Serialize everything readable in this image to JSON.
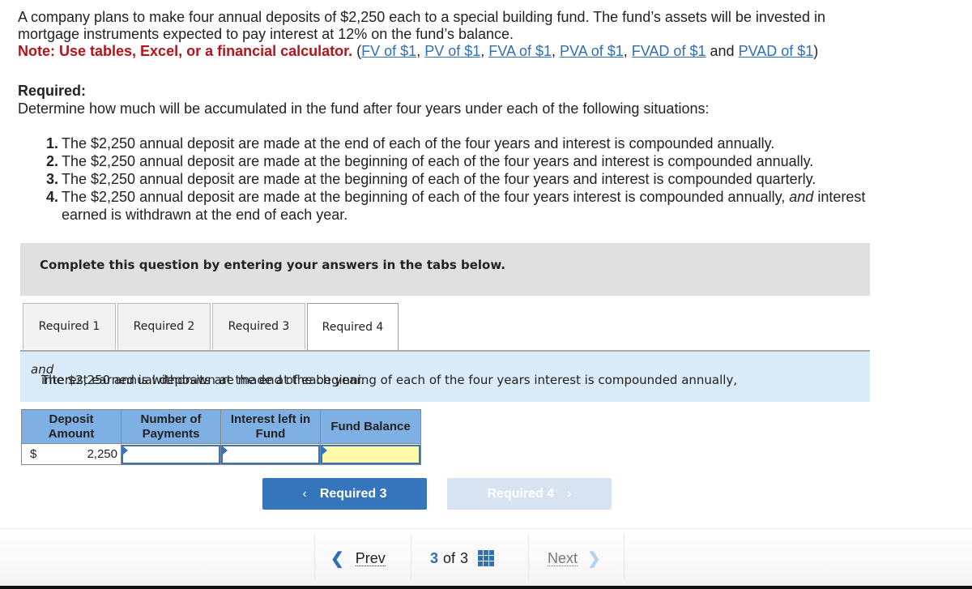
{
  "question": {
    "line1": "A company plans to make four annual deposits of $2,250 each to a special building fund. The fund’s assets will be invested in",
    "line2": "mortgage instruments expected to pay interest at 12% on the fund’s balance.",
    "note": "Note: Use tables, Excel, or a financial calculator.",
    "links": [
      "FV of $1",
      "PV of $1",
      "FVA of $1",
      "PVA of $1",
      "FVAD of $1",
      "PVAD of $1"
    ],
    "and_text": "and"
  },
  "required": {
    "heading": "Required:",
    "intro": "Determine how much will be accumulated in the fund after four years under each of the following situations:",
    "items": [
      {
        "num": "1.",
        "text": "The $2,250 annual deposit are made at the end of each of the four years and interest is compounded annually."
      },
      {
        "num": "2.",
        "text": "The $2,250 annual deposit are made at the beginning of each of the four years and interest is compounded annually."
      },
      {
        "num": "3.",
        "text": "The $2,250 annual deposit are made at the beginning of each of the four years and interest is compounded quarterly."
      },
      {
        "num": "4.",
        "text_a": "The $2,250 annual deposit are made at the beginning of each of the four years interest is compounded annually, ",
        "text_em": "and",
        "text_b": " interest",
        "text_c": "earned is withdrawn at the end of each year."
      }
    ]
  },
  "banner": "Complete this question by entering your answers in the tabs below.",
  "tabs": [
    {
      "label": "Required 1",
      "active": false
    },
    {
      "label": "Required 2",
      "active": false
    },
    {
      "label": "Required 3",
      "active": false
    },
    {
      "label": "Required 4",
      "active": true
    }
  ],
  "panel": {
    "text_a": "The $2,250 annual deposits are made at the beginning of each of the four years interest is compounded annually, ",
    "text_em": "and",
    "text_b": " interest earned is withdrawn at the end of each year."
  },
  "table": {
    "headers": [
      "Deposit Amount",
      "Number of Payments",
      "Interest left in Fund",
      "Fund Balance"
    ],
    "header_lines": [
      [
        "Deposit",
        "Amount"
      ],
      [
        "Number of",
        "Payments"
      ],
      [
        "Interest left in",
        "Fund"
      ],
      [
        "Fund Balance"
      ]
    ],
    "row": {
      "currency": "$",
      "deposit": "2,250",
      "number_of_payments": "",
      "interest_left": "",
      "fund_balance": ""
    }
  },
  "buttons": {
    "prev": {
      "label": "Required 3",
      "chevron": "‹"
    },
    "next": {
      "label": "Required 4",
      "chevron": "›",
      "disabled": true
    }
  },
  "footer": {
    "prev": "Prev",
    "current": "3",
    "of": "of",
    "total": "3",
    "next": "Next"
  },
  "colors": {
    "note_red": "#b5121b",
    "link_blue": "#2f6fb5",
    "button_blue": "#3575bb",
    "header_blue": "#7eb0e4",
    "panel_blue": "#daebf9",
    "answer_yellow": "#fffbaa"
  }
}
